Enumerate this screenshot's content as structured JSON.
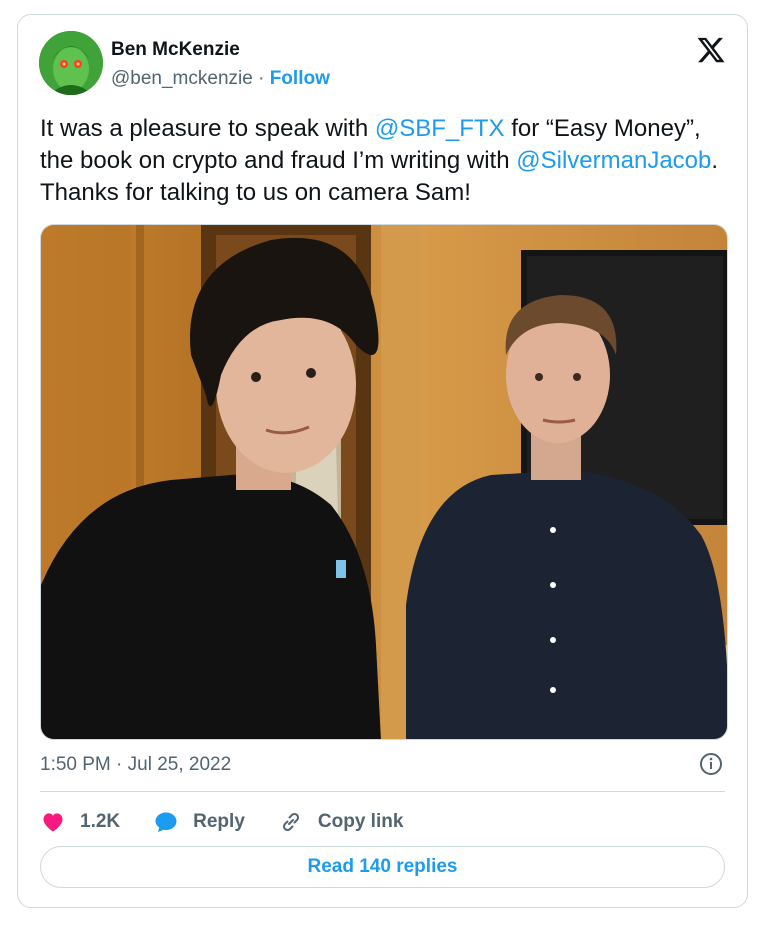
{
  "author": {
    "name": "Ben McKenzie",
    "handle": "@ben_mckenzie",
    "separator": " · ",
    "follow_label": "Follow"
  },
  "tweet": {
    "text_1": "It was a pleasure to speak with ",
    "mention_1": "@SBF_FTX",
    "text_2": " for “Easy Money”, the book on crypto and fraud I’m writing with ",
    "mention_2": "@SilvermanJacob",
    "text_3": ". Thanks for talking to us on camera Sam!"
  },
  "meta": {
    "timestamp": "1:50 PM · Jul 25, 2022"
  },
  "actions": {
    "likes": "1.2K",
    "reply_label": "Reply",
    "copy_link_label": "Copy link",
    "read_replies_label": "Read 140 replies"
  },
  "colors": {
    "accent": "#1d9bf0",
    "like": "#f91880",
    "muted": "#536471",
    "border": "#cfd9de"
  }
}
